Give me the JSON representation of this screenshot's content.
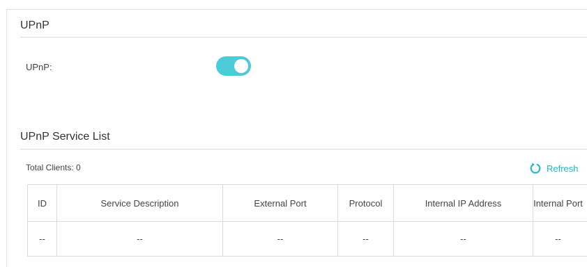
{
  "upnp_section": {
    "title": "UPnP",
    "field_label": "UPnP:",
    "toggle_state": "on"
  },
  "service_section": {
    "title": "UPnP Service List",
    "total_clients": "Total Clients: 0",
    "refresh_label": "Refresh"
  },
  "table": {
    "headers": [
      "ID",
      "Service Description",
      "External Port",
      "Protocol",
      "Internal IP Address",
      "Internal Port"
    ],
    "rows": [
      [
        "--",
        "--",
        "--",
        "--",
        "--",
        "--"
      ]
    ]
  },
  "colors": {
    "accent": "#4acbd6",
    "link": "#28b7c6",
    "border": "#dcdcdc"
  },
  "icons": {
    "refresh": "refresh-icon"
  }
}
